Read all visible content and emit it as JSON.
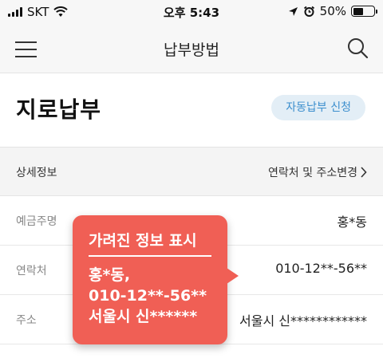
{
  "status_bar": {
    "carrier": "SKT",
    "time": "오후 5:43",
    "battery_percent": "50%",
    "battery_level": 0.5,
    "icons": [
      "signal-bars-icon",
      "wifi-icon",
      "location-arrow-icon",
      "alarm-clock-icon",
      "battery-icon"
    ]
  },
  "nav": {
    "title": "납부방법",
    "menu_icon": "hamburger-menu-icon",
    "search_icon": "search-icon"
  },
  "page": {
    "title": "지로납부",
    "auto_pay_button": "자동납부 신청"
  },
  "section": {
    "title": "상세정보",
    "link": "연락처 및 주소변경",
    "link_icon": "chevron-right-icon"
  },
  "rows": [
    {
      "label": "예금주명",
      "value": "홍*동"
    },
    {
      "label": "연락처",
      "value": "010-12**-56**"
    },
    {
      "label": "주소",
      "value": "서울시 신************"
    }
  ],
  "callout": {
    "title": "가려진 정보 표시",
    "line1": "홍*동,",
    "line2": "010-12**-56**",
    "line3": "서울시 신******"
  },
  "colors": {
    "accent_blue": "#3c8fce",
    "button_bg": "#e3eef6",
    "callout_red": "#f05f55",
    "header_gray": "#f7f7f7"
  }
}
